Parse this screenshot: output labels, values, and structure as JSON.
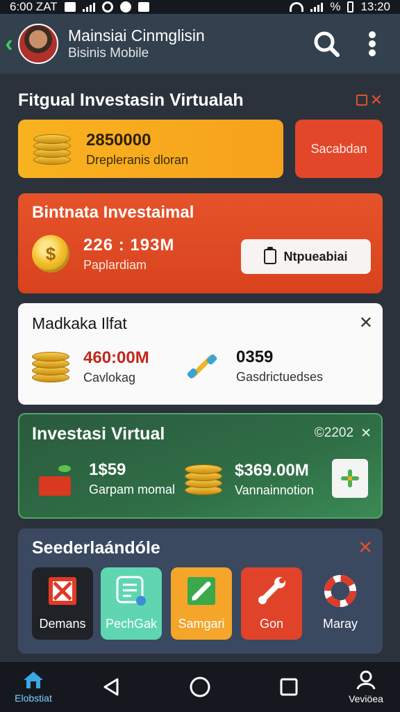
{
  "status_bar": {
    "time_left": "6:00 ZAT",
    "percent": "%",
    "time_right": "13:20"
  },
  "header": {
    "title": "Mainsiai Cinmglisin",
    "subtitle": "Bisinis Mobile",
    "icons": [
      "back-icon",
      "avatar",
      "search-icon",
      "more-vertical-icon"
    ]
  },
  "section": {
    "title": "Fitgual Investasin Virtualah"
  },
  "balance_card": {
    "value": "2850000",
    "label": "Drepleranis dloran",
    "side_button": "Sacabdan"
  },
  "invest_card": {
    "title": "Bintnata Investaimal",
    "value": "226 : 193M",
    "label": "Paplardiam",
    "button": "Ntpueabiai"
  },
  "market_card": {
    "title": "Madkaka Ilfat",
    "stat1_value": "460:00M",
    "stat1_label": "Cavlokag",
    "stat2_value": "0359",
    "stat2_label": "Gasdrictuedses",
    "accent": "#c4271c"
  },
  "virtual_card": {
    "title": "Investasi Virtual",
    "meta": "©2202",
    "stat1_value": "1$59",
    "stat1_label": "Garpam momal",
    "stat2_value": "$369.00M",
    "stat2_label": "Vannainnotion"
  },
  "shortcuts": {
    "title": "Seederlaándóle",
    "items": [
      {
        "label": "Demans",
        "bg": "#1f2328",
        "icon": "close-box-icon"
      },
      {
        "label": "PechGak",
        "bg": "#5fd6b0",
        "icon": "list-icon"
      },
      {
        "label": "Samgari",
        "bg": "#f4a52a",
        "icon": "edit-icon"
      },
      {
        "label": "Gon",
        "bg": "#e1432a",
        "icon": "wrench-icon"
      },
      {
        "label": "Maray",
        "bg": "#3a4860",
        "icon": "lifebuoy-icon"
      }
    ]
  },
  "bottom_nav": {
    "home_label": "Elobstiat",
    "profile_label": "Veviöea",
    "icons": [
      "home-icon",
      "back-triangle-icon",
      "home-circle-icon",
      "recents-square-icon",
      "profile-icon"
    ]
  }
}
